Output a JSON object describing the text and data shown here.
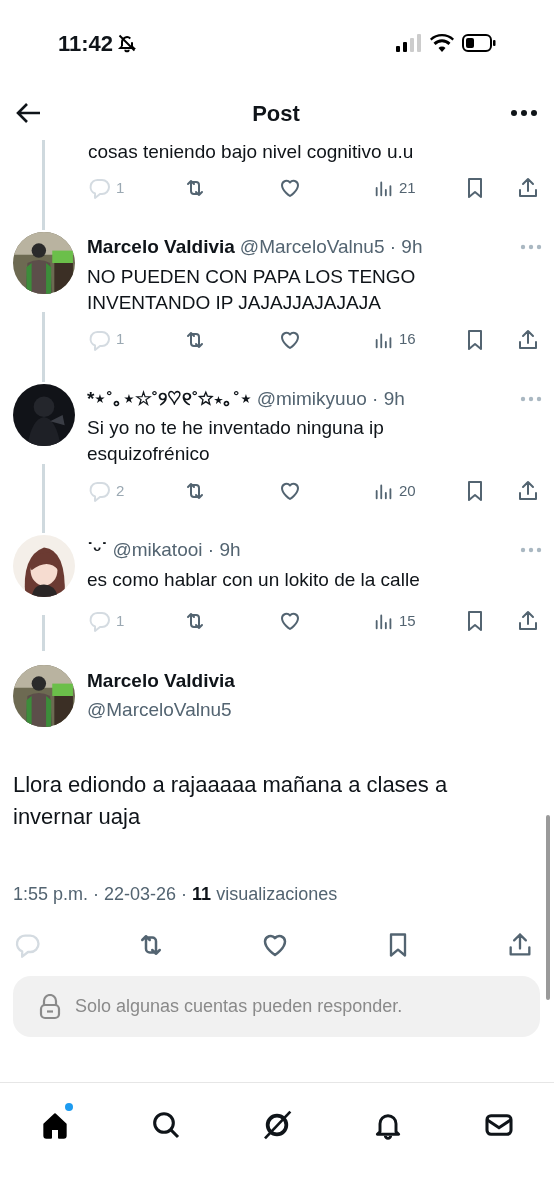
{
  "status_bar": {
    "time": "11:42"
  },
  "header": {
    "title": "Post"
  },
  "replies": [
    {
      "text": "cosas teniendo bajo nivel cognitivo u.u",
      "reply_count": "1",
      "view_count": "21"
    },
    {
      "name": "Marcelo Valdivia",
      "handle": "@MarceloValnu5 · 9h",
      "text": "NO PUEDEN CON PAPA LOS TENGO INVENTANDO IP JAJAJJAJAJAJA",
      "reply_count": "1",
      "view_count": "16"
    },
    {
      "name": "*⋆˚｡⋆☆˚୨♡୧˚☆⋆｡˚⋆",
      "handle": "@mimikyuuo · 9h",
      "text": "Si yo no te he inventado ninguna ip esquizofrénico",
      "reply_count": "2",
      "view_count": "20"
    },
    {
      "name": "˙ᵕ˙",
      "handle": "@mikatooi · 9h",
      "text": "es como hablar con un lokito de la calle",
      "reply_count": "1",
      "view_count": "15"
    }
  ],
  "main_post": {
    "name": "Marcelo Valdivia",
    "handle": "@MarceloValnu5",
    "text": "Llora ediondo a rajaaaaa mañana a clases a invernar uaja",
    "meta": "1:55 p.m. · 22-03-26 · **11** visualizaciones"
  },
  "reply_notice": "Solo algunas cuentas pueden responder.",
  "nav": [
    {
      "kind": "home",
      "selected": true,
      "badge": true
    },
    {
      "kind": "search",
      "selected": false,
      "badge": false
    },
    {
      "kind": "grok",
      "selected": false,
      "badge": false
    },
    {
      "kind": "notifications",
      "selected": false,
      "badge": false
    },
    {
      "kind": "messages",
      "selected": false,
      "badge": false
    }
  ]
}
